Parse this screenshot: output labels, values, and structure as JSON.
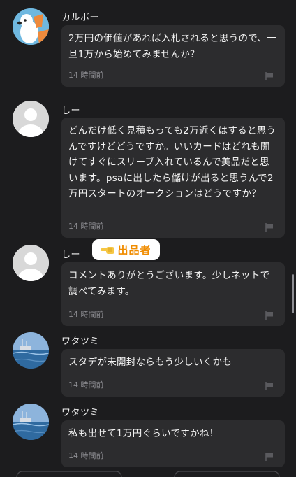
{
  "comments": [
    {
      "user": "カルボー",
      "avatar": "dog-avatar",
      "text": "2万円の価値があれば入札されると思うので、一旦1万から始めてみませんか？",
      "time": "14 時間前"
    },
    {
      "user": "しー",
      "avatar": "default-avatar",
      "text": "どんだけ低く見積もっても2万近くはすると思うんですけどどうですか。いいカードはどれも開けてすぐにスリーブ入れているんで美品だと思います。psaに出したら儲けが出ると思うんで2万円スタートのオークションはどうですか？",
      "time": "14 時間前"
    },
    {
      "user": "しー",
      "avatar": "default-avatar",
      "badge": "出品者",
      "text": "コメントありがとうございます。少しネットで調べてみます。",
      "time": "14 時間前"
    },
    {
      "user": "ワタツミ",
      "avatar": "sea-avatar",
      "text": "スタデが未開封ならもう少しいくかも",
      "time": "14 時間前"
    },
    {
      "user": "ワタツミ",
      "avatar": "sea-avatar",
      "text": "私も出せて1万円ぐらいですかね！",
      "time": "14 時間前"
    }
  ],
  "colors": {
    "background": "#1c1c1e",
    "bubble": "#2c2c2e",
    "seller_badge_text": "#f08c00"
  }
}
